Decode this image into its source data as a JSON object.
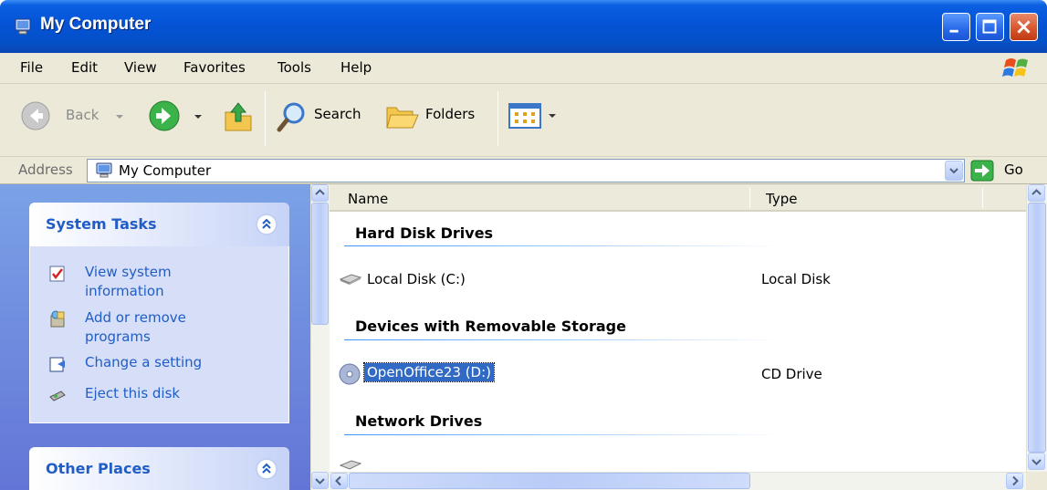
{
  "window": {
    "title": "My Computer"
  },
  "menu": {
    "items": [
      "File",
      "Edit",
      "View",
      "Favorites",
      "Tools",
      "Help"
    ]
  },
  "toolbar": {
    "back_label": "Back",
    "search_label": "Search",
    "folders_label": "Folders"
  },
  "address": {
    "label": "Address",
    "value": "My Computer",
    "go_label": "Go"
  },
  "taskpane": {
    "system_tasks": {
      "title": "System Tasks",
      "tasks": [
        {
          "label_line1": "View system",
          "label_line2": "information",
          "icon": "system-info-icon"
        },
        {
          "label_line1": "Add or remove",
          "label_line2": "programs",
          "icon": "add-remove-programs-icon"
        },
        {
          "label_line1": "Change a setting",
          "label_line2": "",
          "icon": "control-panel-icon"
        },
        {
          "label_line1": "Eject this disk",
          "label_line2": "",
          "icon": "eject-icon"
        }
      ]
    },
    "other_places": {
      "title": "Other Places"
    }
  },
  "content": {
    "columns": [
      "Name",
      "Type"
    ],
    "groups": [
      {
        "title": "Hard Disk Drives",
        "items": [
          {
            "name": "Local Disk (C:)",
            "type": "Local Disk",
            "icon": "hard-disk-icon"
          }
        ]
      },
      {
        "title": "Devices with Removable Storage",
        "items": [
          {
            "name": "OpenOffice23 (D:)",
            "type": "CD Drive",
            "icon": "cd-drive-icon",
            "selected": true
          }
        ]
      },
      {
        "title": "Network Drives",
        "items": []
      }
    ]
  },
  "colors": {
    "titlebar": "#0553d6",
    "task_link": "#215dc6",
    "selection": "#316ac5",
    "taskpane_bg": "#7ba2e7"
  }
}
